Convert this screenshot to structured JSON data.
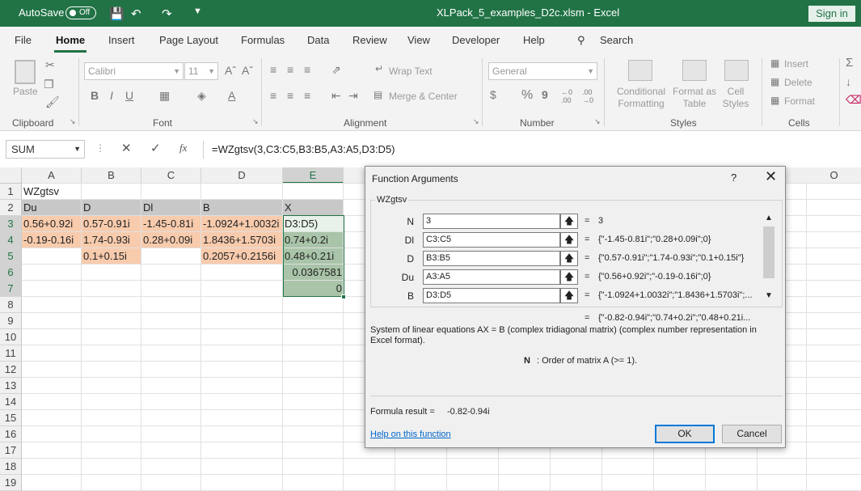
{
  "titlebar": {
    "autosave_label": "AutoSave",
    "autosave_state": "Off",
    "title": "XLPack_5_examples_D2c.xlsm  -  Excel",
    "signin": "Sign in"
  },
  "menu": {
    "items": [
      "File",
      "Home",
      "Insert",
      "Page Layout",
      "Formulas",
      "Data",
      "Review",
      "View",
      "Developer",
      "Help"
    ],
    "search": "Search"
  },
  "ribbon": {
    "clipboard": {
      "label": "Clipboard",
      "paste": "Paste"
    },
    "font": {
      "label": "Font",
      "name": "Calibri",
      "size": "11",
      "bold": "B",
      "italic": "I",
      "underline": "U"
    },
    "alignment": {
      "label": "Alignment",
      "wrap": "Wrap Text",
      "merge": "Merge & Center"
    },
    "number": {
      "label": "Number",
      "format": "General",
      "percent": "%",
      "comma": "9",
      "inc": "€0\n.00",
      "dec": ".00\n→0"
    },
    "styles": {
      "label": "Styles",
      "conditional": "Conditional\nFormatting",
      "format_table": "Format as\nTable",
      "cell_styles": "Cell\nStyles"
    },
    "cells": {
      "label": "Cells",
      "insert": "Insert",
      "delete": "Delete",
      "format": "Format"
    }
  },
  "formula_bar": {
    "name_box": "SUM",
    "formula": "=WZgtsv(3,C3:C5,B3:B5,A3:A5,D3:D5)"
  },
  "grid": {
    "columns": [
      "A",
      "B",
      "C",
      "D",
      "E",
      "O"
    ],
    "rows": [
      "1",
      "2",
      "3",
      "4",
      "5",
      "6",
      "7",
      "8",
      "9",
      "10",
      "11",
      "12",
      "13",
      "14",
      "15",
      "16",
      "17",
      "18",
      "19"
    ],
    "cells": {
      "A1": "WZgtsv",
      "A2": "Du",
      "B2": "D",
      "C2": "Dl",
      "D2": "B",
      "E2": "X",
      "A3": "0.56+0.92i",
      "B3": "0.57-0.91i",
      "C3": "-1.45-0.81i",
      "D3": "-1.0924+1.0032i",
      "E3": "D3:D5)",
      "A4": "-0.19-0.16i",
      "B4": "1.74-0.93i",
      "C4": "0.28+0.09i",
      "D4": "1.8436+1.5703i",
      "E4": "0.74+0.2i",
      "B5": "0.1+0.15i",
      "D5": "0.2057+0.2156i",
      "E5": "0.48+0.21i",
      "E6": "0.0367581",
      "E7": "0"
    },
    "colors": {
      "header": "#c8c8c8",
      "input": "#f8cbad",
      "output": "#a9c4a8",
      "selected": "#e8f2e8"
    }
  },
  "dialog": {
    "title": "Function Arguments",
    "help": "?",
    "close": "✕",
    "function_name": "WZgtsv",
    "args": [
      {
        "label": "N",
        "input": "3",
        "value": "3"
      },
      {
        "label": "Dl",
        "input": "C3:C5",
        "value": "{\"-1.45-0.81i\";\"0.28+0.09i\";0}"
      },
      {
        "label": "D",
        "input": "B3:B5",
        "value": "{\"0.57-0.91i\";\"1.74-0.93i\";\"0.1+0.15i\"}"
      },
      {
        "label": "Du",
        "input": "A3:A5",
        "value": "{\"0.56+0.92i\";\"-0.19-0.16i\";0}"
      },
      {
        "label": "B",
        "input": "D3:D5",
        "value": "{\"-1.0924+1.0032i\";\"1.8436+1.5703i\";..."
      }
    ],
    "equals": "=",
    "result_preview": "{\"-0.82-0.94i\";\"0.74+0.2i\";\"0.48+0.21i...",
    "description": "System of linear equations AX = B (complex tridiagonal matrix) (complex number representation in Excel format).",
    "arg_help_name": "N",
    "arg_help_text": ":  Order of matrix A (>= 1).",
    "formula_result_label": "Formula result =",
    "formula_result": "-0.82-0.94i",
    "help_link": "Help on this function",
    "ok": "OK",
    "cancel": "Cancel"
  }
}
